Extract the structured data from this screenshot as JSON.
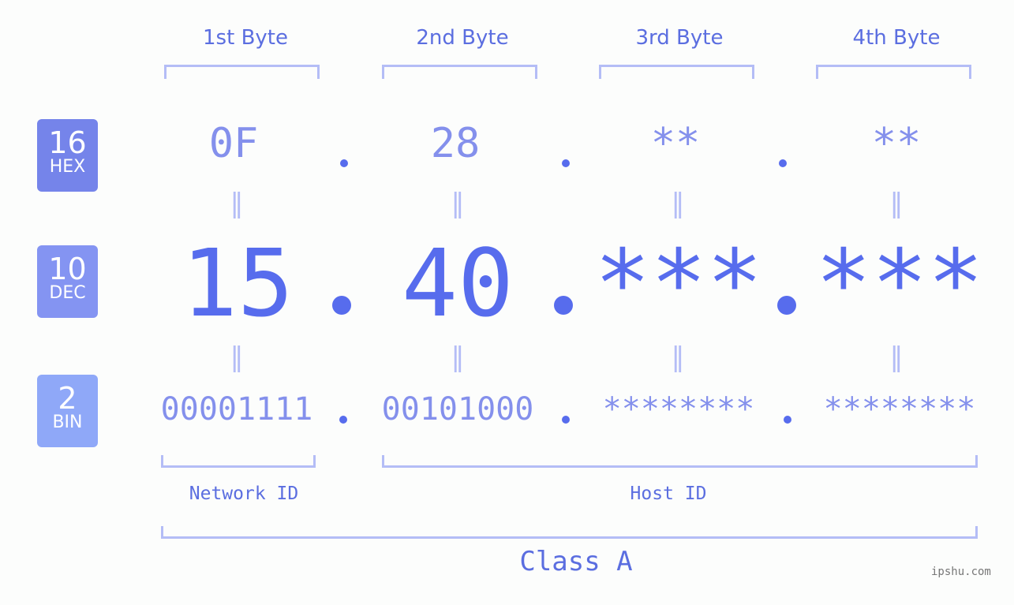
{
  "headers": [
    "1st Byte",
    "2nd Byte",
    "3rd Byte",
    "4th Byte"
  ],
  "badges": [
    {
      "number": "16",
      "label": "HEX",
      "color": "#7584ea"
    },
    {
      "number": "10",
      "label": "DEC",
      "color": "#8494f2"
    },
    {
      "number": "2",
      "label": "BIN",
      "color": "#8fa8f8"
    }
  ],
  "hex": [
    "0F",
    "28",
    "**",
    "**"
  ],
  "dec": [
    "15",
    "40",
    "***",
    "***"
  ],
  "bin": [
    "00001111",
    "00101000",
    "********",
    "********"
  ],
  "equals": "=",
  "labels": {
    "network": "Network ID",
    "host": "Host ID",
    "class": "Class A"
  },
  "watermark": "ipshu.com",
  "colors": {
    "accent": "#576ced",
    "light": "#8490ec",
    "bracket": "#b4bdf6"
  }
}
